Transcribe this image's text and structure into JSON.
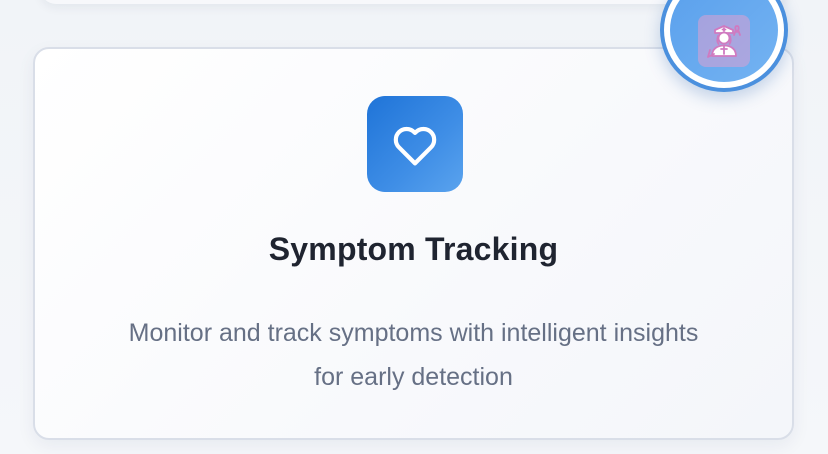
{
  "feature_card": {
    "icon": "heart-icon",
    "title": "Symptom Tracking",
    "description": "Monitor and track symptoms with intelligent insights for early detection"
  },
  "avatar": {
    "icon": "nurse-chat-icon"
  },
  "colors": {
    "accent": "#2f80e0",
    "title_text": "#1f2430",
    "body_text": "#667085",
    "avatar_border": "#4b90de",
    "nurse_icon": "#d07ac0"
  }
}
